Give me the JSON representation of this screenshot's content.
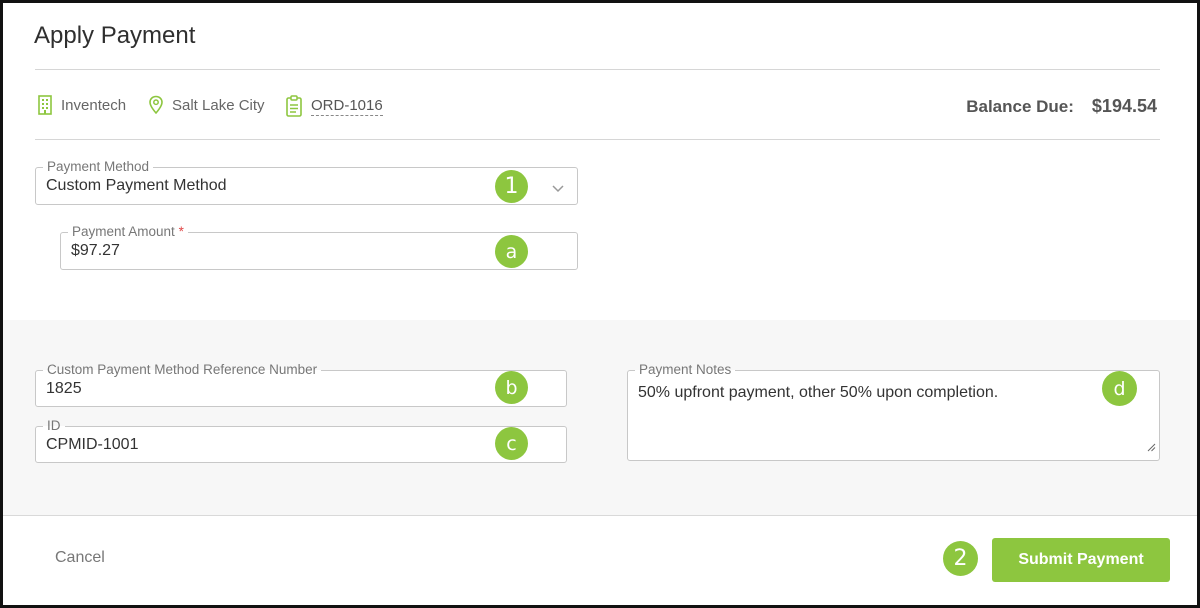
{
  "dialog": {
    "title": "Apply Payment"
  },
  "meta": {
    "company": "Inventech",
    "city": "Salt Lake City",
    "order": "ORD-1016"
  },
  "balance": {
    "label": "Balance Due:",
    "value": "$194.54"
  },
  "payment_method": {
    "label": "Payment Method",
    "value": "Custom Payment Method"
  },
  "payment_amount": {
    "label": "Payment Amount",
    "required_mark": "*",
    "value": "$97.27"
  },
  "reference_number": {
    "label": "Custom Payment Method Reference Number",
    "value": "1825"
  },
  "id_field": {
    "label": "ID",
    "value": "CPMID-1001"
  },
  "notes": {
    "label": "Payment Notes",
    "value": "50% upfront payment, other 50% upon completion."
  },
  "badges": {
    "b1": "1",
    "ba": "a",
    "bb": "b",
    "bc": "c",
    "bd": "d",
    "b2": "2"
  },
  "footer": {
    "cancel": "Cancel",
    "submit": "Submit Payment"
  },
  "colors": {
    "accent": "#8dc63f",
    "required": "#e04646"
  },
  "icons": {
    "company": "building-icon",
    "city": "map-pin-icon",
    "order": "clipboard-icon"
  }
}
